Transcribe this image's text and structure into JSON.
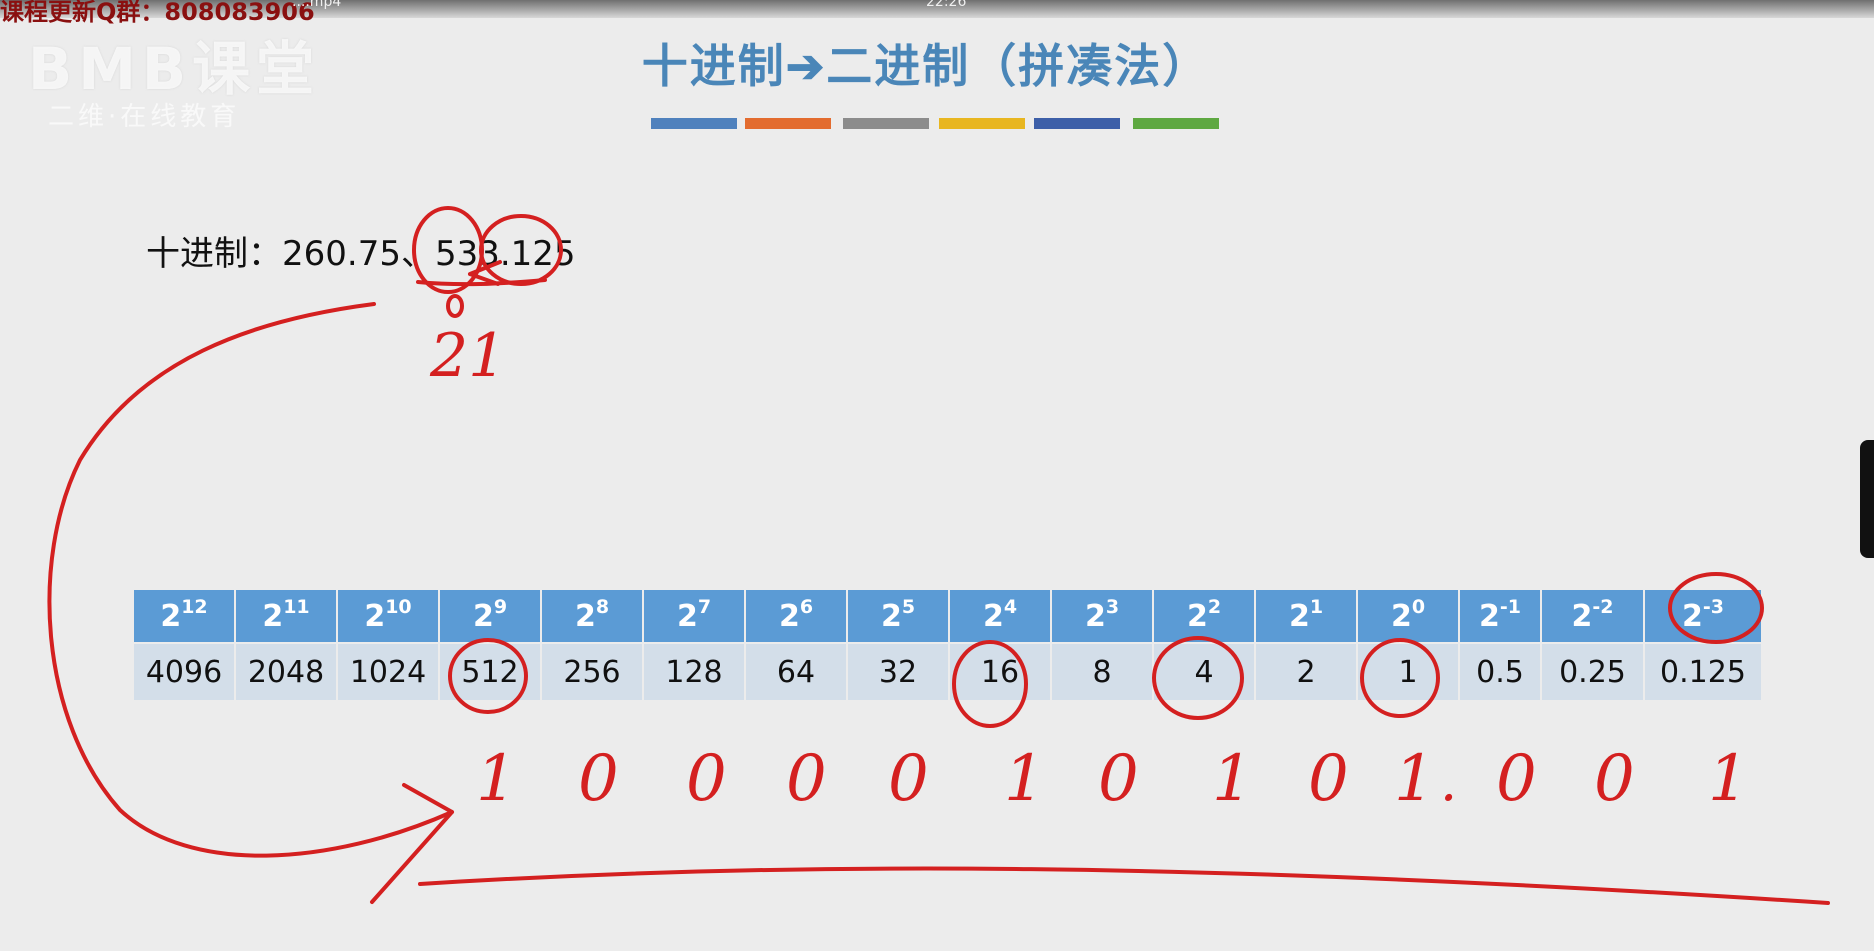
{
  "video": {
    "overlay_text": "课程更新Q群：808083906",
    "file_name": "....mp4",
    "clock": "22:26"
  },
  "watermark": {
    "logo": "BMB课堂",
    "sub": "二维·在线教育"
  },
  "slide": {
    "title": "十进制➔二进制（拼凑法）",
    "accent_colors": [
      "#4f81bd",
      "#e36c2f",
      "#8c8c8c",
      "#e8b620",
      "#3d5fa8",
      "#5ea841"
    ],
    "decimal_label": "十进制：",
    "decimal_values": "260.75、533.125"
  },
  "power_table": {
    "header_color": "#5b9bd5",
    "value_row_color": "#d3dee9",
    "columns": [
      {
        "base": "2",
        "exp": "12",
        "value": "4096"
      },
      {
        "base": "2",
        "exp": "11",
        "value": "2048"
      },
      {
        "base": "2",
        "exp": "10",
        "value": "1024"
      },
      {
        "base": "2",
        "exp": "9",
        "value": "512"
      },
      {
        "base": "2",
        "exp": "8",
        "value": "256"
      },
      {
        "base": "2",
        "exp": "7",
        "value": "128"
      },
      {
        "base": "2",
        "exp": "6",
        "value": "64"
      },
      {
        "base": "2",
        "exp": "5",
        "value": "32"
      },
      {
        "base": "2",
        "exp": "4",
        "value": "16"
      },
      {
        "base": "2",
        "exp": "3",
        "value": "8"
      },
      {
        "base": "2",
        "exp": "2",
        "value": "4"
      },
      {
        "base": "2",
        "exp": "1",
        "value": "2"
      },
      {
        "base": "2",
        "exp": "0",
        "value": "1"
      },
      {
        "base": "2",
        "exp": "-1",
        "value": "0.5"
      },
      {
        "base": "2",
        "exp": "-2",
        "value": "0.25"
      },
      {
        "base": "2",
        "exp": "-3",
        "value": "0.125"
      }
    ]
  },
  "annotations": {
    "ink_color": "#d42020",
    "remainder_note": "21",
    "binary_digits": [
      "1",
      "0",
      "0",
      "0",
      "0",
      "1",
      "0",
      "1",
      "0",
      "1",
      ".",
      "0",
      "0",
      "1"
    ]
  }
}
